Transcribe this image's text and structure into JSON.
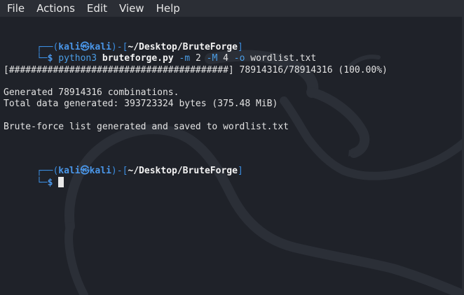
{
  "menu": {
    "items": [
      "File",
      "Actions",
      "Edit",
      "View",
      "Help"
    ]
  },
  "terminal": {
    "prompt1": {
      "corner_top": "┌──(",
      "user": "kali",
      "at_symbol": "㉿",
      "host": "kali",
      "sep": ")-[",
      "path": "~/Desktop/BruteForge",
      "close": "]",
      "corner_bottom": "└─",
      "dollar": "$ ",
      "cmd": "python3",
      "script": "bruteforge.py",
      "flag_m": "-m",
      "val_m": "2",
      "flag_M": "-M",
      "val_M": "4",
      "flag_o": "-o",
      "val_o": "wordlist.txt"
    },
    "progress_line": "[########################################] 78914316/78914316 (100.00%)",
    "output_lines": [
      "Generated 78914316 combinations.",
      "Total data generated: 393723324 bytes (375.48 MiB)",
      "Brute-force list generated and saved to wordlist.txt"
    ],
    "prompt2": {
      "corner_top": "┌──(",
      "user": "kali",
      "at_symbol": "㉿",
      "host": "kali",
      "sep": ")-[",
      "path": "~/Desktop/BruteForge",
      "close": "]",
      "corner_bottom": "└─",
      "dollar": "$ "
    }
  },
  "colors": {
    "background": "#1f2229",
    "menubar": "#2b2e35",
    "prompt_blue": "#3b8de0",
    "text": "#e2e2e2"
  },
  "icons": {
    "watermark": "kali-dragon-icon",
    "cursor": "text-cursor"
  }
}
